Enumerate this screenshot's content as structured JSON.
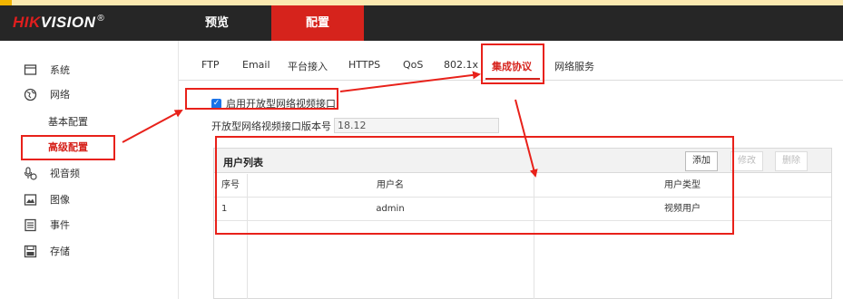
{
  "brand": {
    "name_red": "HIK",
    "name_white": "VISION",
    "mark": "®"
  },
  "top_nav": {
    "preview": "预览",
    "config": "配置"
  },
  "sidebar": {
    "items": [
      {
        "label": "系统",
        "icon": "monitor-icon"
      },
      {
        "label": "网络",
        "icon": "globe-icon"
      },
      {
        "label": "基本配置"
      },
      {
        "label": "高级配置"
      },
      {
        "label": "视音频",
        "icon": "microphone-camera-icon"
      },
      {
        "label": "图像",
        "icon": "image-icon"
      },
      {
        "label": "事件",
        "icon": "document-list-icon"
      },
      {
        "label": "存储",
        "icon": "floppy-disk-icon"
      }
    ],
    "active": "高级配置"
  },
  "tabs": [
    "FTP",
    "Email",
    "平台接入",
    "HTTPS",
    "QoS",
    "802.1x",
    "集成协议",
    "网络服务"
  ],
  "active_tab": "集成协议",
  "checkbox": {
    "label": "启用开放型网络视频接口",
    "checked": true
  },
  "version": {
    "label": "开放型网络视频接口版本号",
    "value": "18.12"
  },
  "user_list": {
    "title": "用户列表",
    "buttons": {
      "add": "添加",
      "edit": "修改",
      "delete": "删除"
    },
    "columns": [
      "序号",
      "用户名",
      "用户类型"
    ],
    "rows": [
      {
        "no": "1",
        "name": "admin",
        "type": "视频用户"
      }
    ]
  },
  "colors": {
    "accent": "#d6231c",
    "header_bg": "#262626",
    "checkbox": "#1a73e8",
    "annotation": "#e8211a"
  }
}
